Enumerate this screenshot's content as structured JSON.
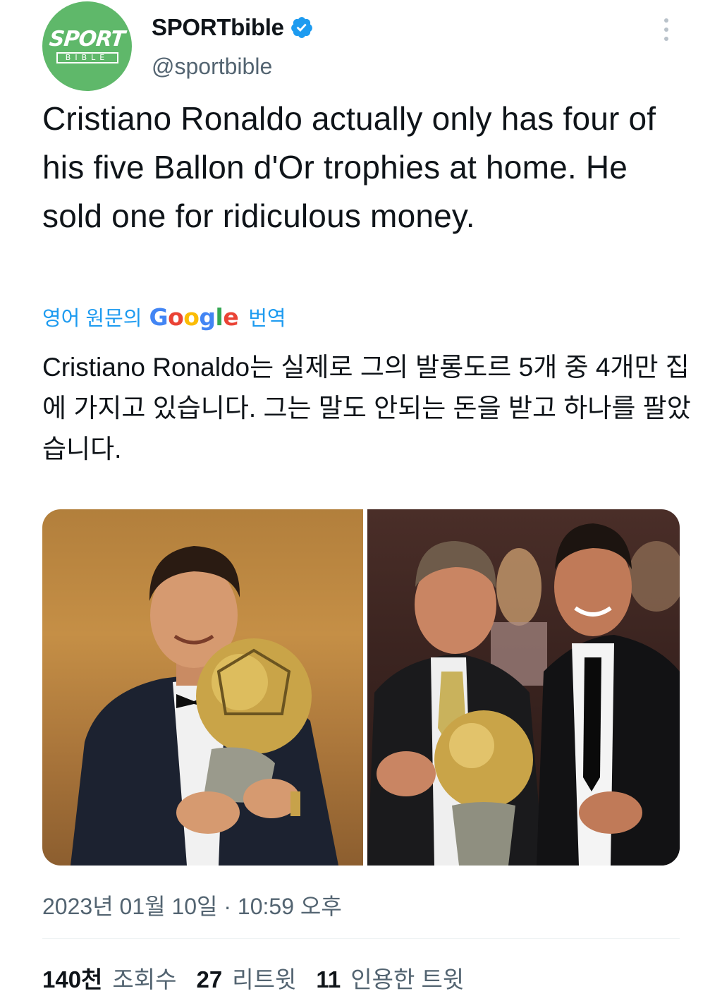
{
  "account": {
    "name": "SPORTbible",
    "handle": "@sportbible",
    "avatar_top_text": "SPORT",
    "avatar_bottom_text": "BIBLE",
    "verified": true,
    "avatar_color": "#5fb86a"
  },
  "tweet": {
    "text": "Cristiano Ronaldo actually only has four of his five Ballon d'Or trophies at home. He sold one for ridiculous money."
  },
  "translation": {
    "prefix_label": "영어 원문의",
    "google_letters": [
      "G",
      "o",
      "o",
      "g",
      "l",
      "e"
    ],
    "suffix_label": "번역",
    "text": "Cristiano Ronaldo는 실제로 그의 발롱도르 5개 중 4개만 집에 가지고 있습니다. 그는 말도 안되는 돈을 받고 하나를 팔았습니다."
  },
  "media": {
    "images": [
      "ronaldo-holding-ballon-dor-photo",
      "two-men-with-ballon-dor-photo"
    ]
  },
  "meta": {
    "timestamp": "2023년 01월 10일 · 10:59 오후"
  },
  "stats": {
    "views_count": "140천",
    "views_label": "조회수",
    "retweets_count": "27",
    "retweets_label": "리트윗",
    "quotes_count": "11",
    "quotes_label": "인용한 트윗"
  },
  "colors": {
    "accent": "#1d9bf0",
    "text": "#0f1419",
    "secondary": "#536471"
  }
}
